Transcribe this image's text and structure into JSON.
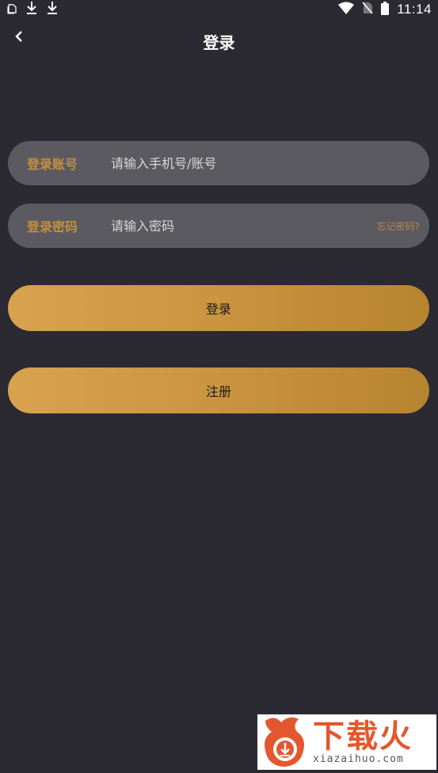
{
  "status_bar": {
    "time": "11:14",
    "icons": [
      "notification-icon",
      "download-icon",
      "download-icon",
      "wifi-icon",
      "no-sim-icon",
      "battery-icon"
    ]
  },
  "nav": {
    "back_icon": "chevron-left-icon",
    "title": "登录"
  },
  "form": {
    "account": {
      "label": "登录账号",
      "value": "",
      "placeholder": "请输入手机号/账号"
    },
    "password": {
      "label": "登录密码",
      "value": "",
      "placeholder": "请输入密码",
      "forgot_label": "忘记密码?"
    }
  },
  "actions": {
    "login_label": "登录",
    "register_label": "注册"
  },
  "watermark": {
    "brand": "下载火",
    "url": "xiazaihuo.com"
  },
  "colors": {
    "background": "#2b2a33",
    "field_bg": "#5b5a60",
    "accent_gold": "#c48f3d",
    "button_gradient_start": "#d8a24e",
    "button_gradient_end": "#b7842f"
  }
}
